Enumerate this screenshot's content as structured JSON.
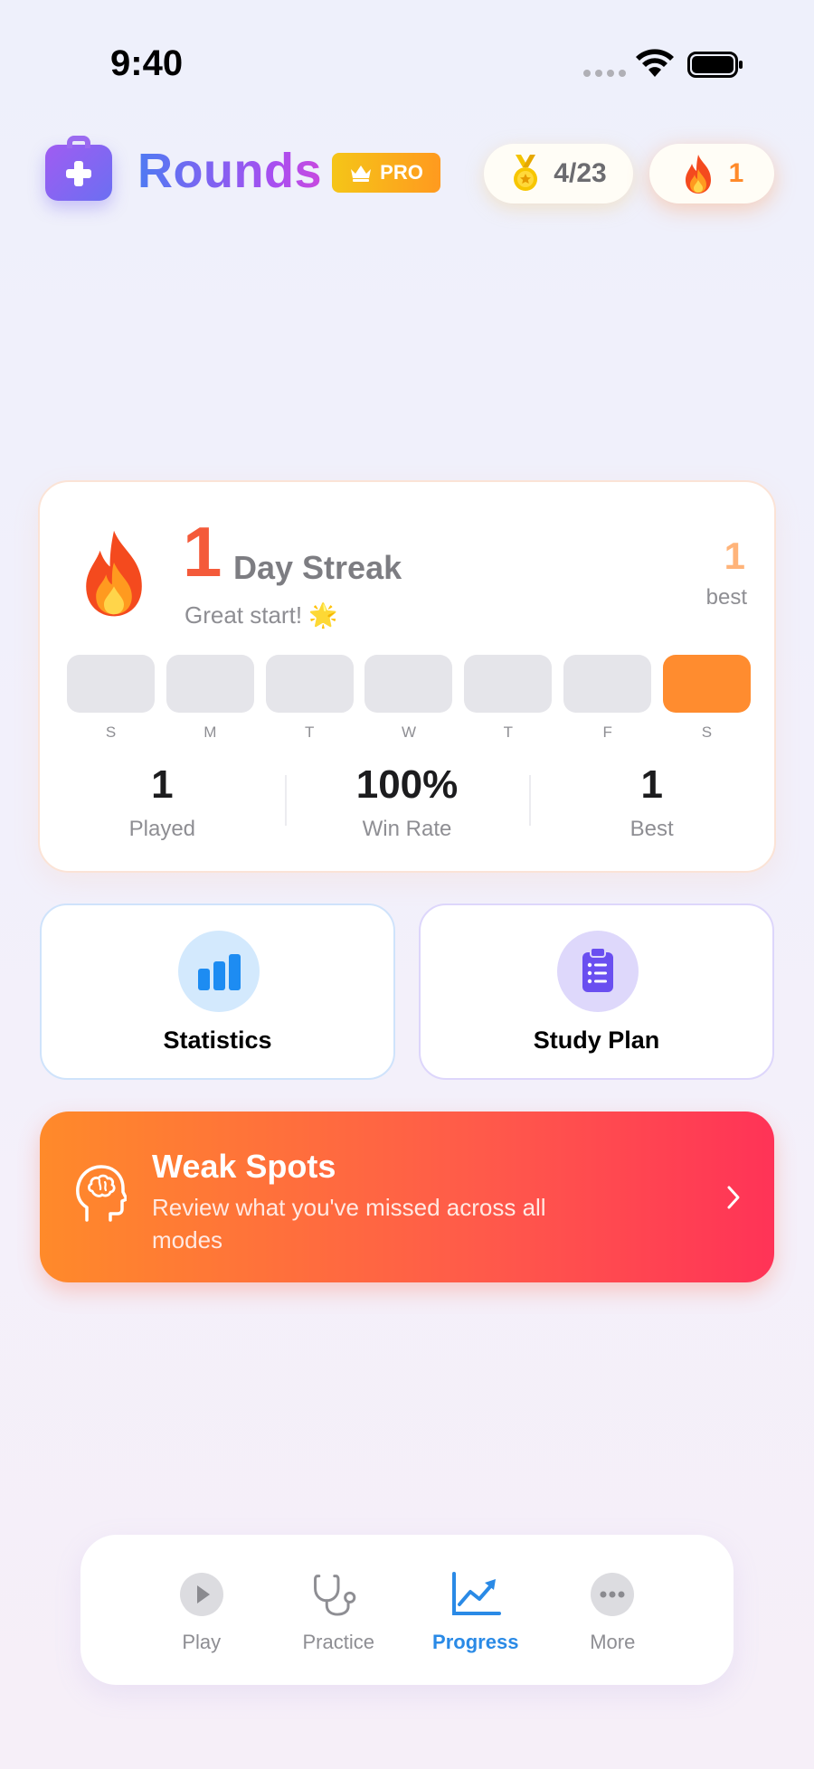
{
  "status_bar": {
    "time": "9:40"
  },
  "header": {
    "app_title": "Rounds",
    "pro_label": "PRO",
    "medals": "4/23",
    "streak_count": "1"
  },
  "streak_card": {
    "count": "1",
    "label": "Day Streak",
    "subtitle": "Great start!",
    "subtitle_emoji": "🌟",
    "best_value": "1",
    "best_label": "best",
    "week": [
      {
        "letter": "S",
        "done": false
      },
      {
        "letter": "M",
        "done": false
      },
      {
        "letter": "T",
        "done": false
      },
      {
        "letter": "W",
        "done": false
      },
      {
        "letter": "T",
        "done": false
      },
      {
        "letter": "F",
        "done": false
      },
      {
        "letter": "S",
        "done": true
      }
    ],
    "stats": [
      {
        "value": "1",
        "label": "Played"
      },
      {
        "value": "100%",
        "label": "Win Rate"
      },
      {
        "value": "1",
        "label": "Best"
      }
    ]
  },
  "actions": {
    "statistics_label": "Statistics",
    "study_plan_label": "Study Plan"
  },
  "weak_spots": {
    "title": "Weak Spots",
    "description": "Review what you've missed across all modes"
  },
  "tab_bar": {
    "tabs": [
      {
        "label": "Play",
        "icon": "play-icon",
        "active": false
      },
      {
        "label": "Practice",
        "icon": "stethoscope-icon",
        "active": false
      },
      {
        "label": "Progress",
        "icon": "chart-line-icon",
        "active": true
      },
      {
        "label": "More",
        "icon": "more-icon",
        "active": false
      }
    ]
  },
  "colors": {
    "streak_orange": "#ff8c2f",
    "streak_red": "#f45a3a",
    "active_tab_blue": "#2a8ae6",
    "weak_gradient_start": "#ff8a2a",
    "weak_gradient_end": "#ff3357"
  }
}
